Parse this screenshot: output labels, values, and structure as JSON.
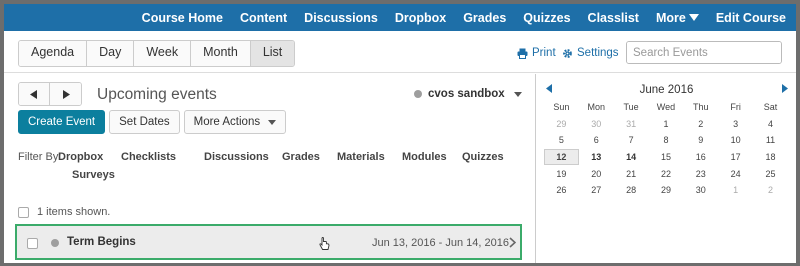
{
  "nav": {
    "items": [
      "Course Home",
      "Content",
      "Discussions",
      "Dropbox",
      "Grades",
      "Quizzes",
      "Classlist"
    ],
    "more": "More",
    "edit": "Edit Course"
  },
  "toolbar": {
    "views": [
      "Agenda",
      "Day",
      "Week",
      "Month",
      "List"
    ],
    "active_view": "List",
    "print": "Print",
    "settings": "Settings",
    "search_placeholder": "Search Events"
  },
  "events": {
    "title": "Upcoming events",
    "calendar_name": "cvos sandbox",
    "create": "Create Event",
    "set_dates": "Set Dates",
    "more_actions": "More Actions",
    "filter_label": "Filter By:",
    "filters": [
      "Dropbox",
      "Checklists",
      "Discussions",
      "Grades",
      "Materials",
      "Modules",
      "Quizzes",
      "Surveys"
    ],
    "shown": "1 items shown.",
    "items": [
      {
        "title": "Term Begins",
        "dates": "Jun 13, 2016 - Jun 14, 2016"
      }
    ]
  },
  "minical": {
    "title": "June 2016",
    "weekdays": [
      "Sun",
      "Mon",
      "Tue",
      "Wed",
      "Thu",
      "Fri",
      "Sat"
    ],
    "weeks": [
      [
        "29",
        "30",
        "31",
        "1",
        "2",
        "3",
        "4"
      ],
      [
        "5",
        "6",
        "7",
        "8",
        "9",
        "10",
        "11"
      ],
      [
        "12",
        "13",
        "14",
        "15",
        "16",
        "17",
        "18"
      ],
      [
        "19",
        "20",
        "21",
        "22",
        "23",
        "24",
        "25"
      ],
      [
        "26",
        "27",
        "28",
        "29",
        "30",
        "1",
        "2"
      ]
    ],
    "selected": "12",
    "bold_days": [
      "13",
      "14"
    ],
    "colors": {
      "accent": "#1e6fa8",
      "primary_button": "#0c7f9e",
      "highlight_border": "#3bab6a"
    }
  }
}
